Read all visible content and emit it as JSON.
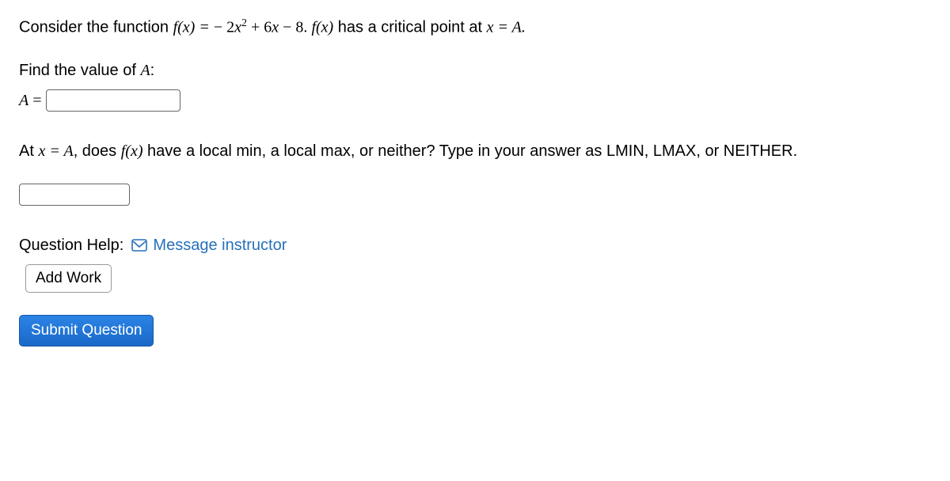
{
  "q": {
    "intro_before": "Consider the function ",
    "fx_eq": "f(x) = ",
    "neg": " − ",
    "term1a": "2",
    "term1b": "x",
    "term1sup": "2",
    "plus": " + 6",
    "term2": "x",
    "minus8": " − 8. ",
    "fx2": "f(x)",
    "intro_after": " has a critical point at ",
    "x_eq_A": "x = A.",
    "find_A": "Find the value of ",
    "A_colon": "A",
    "colon": ":",
    "A_equals_pre": "A",
    "A_equals": " = ",
    "at_x_pre": "At ",
    "x_eq_A2": "x = A",
    "at_x_mid": ", does ",
    "fx3": "f(x)",
    "at_x_after": " have a local min, a local max, or neither? Type in your answer as LMIN, LMAX, or NEITHER."
  },
  "help": {
    "label": "Question Help:",
    "msg": "Message instructor",
    "addwork": "Add Work"
  },
  "submit": "Submit Question"
}
